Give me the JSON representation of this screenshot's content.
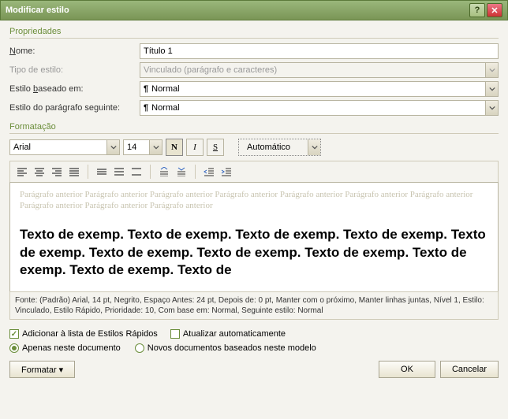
{
  "window": {
    "title": "Modificar estilo"
  },
  "sections": {
    "properties": "Propriedades",
    "formatting": "Formatação"
  },
  "props": {
    "name_label": "Nome:",
    "name_value": "Título 1",
    "styletype_label": "Tipo de estilo:",
    "styletype_value": "Vinculado (parágrafo e caracteres)",
    "basedon_label": "Estilo baseado em:",
    "basedon_value": "Normal",
    "followpara_label": "Estilo do parágrafo seguinte:",
    "followpara_value": "Normal"
  },
  "toolbar": {
    "font": "Arial",
    "size": "14",
    "bold": "N",
    "italic": "I",
    "underline": "S",
    "color": "Automático"
  },
  "preview": {
    "before": "Parágrafo anterior Parágrafo anterior Parágrafo anterior Parágrafo anterior Parágrafo anterior Parágrafo anterior Parágrafo anterior Parágrafo anterior Parágrafo anterior Parágrafo anterior",
    "sample": "Texto de exemp. Texto de exemp. Texto de exemp. Texto de exemp. Texto de exemp. Texto de exemp. Texto de exemp. Texto de exemp. Texto de exemp. Texto de exemp. Texto de"
  },
  "description": "Fonte: (Padrão) Arial, 14 pt, Negrito, Espaço Antes:  24 pt, Depois de:  0 pt, Manter com o próximo, Manter linhas juntas, Nível 1, Estilo: Vinculado, Estilo Rápido, Prioridade: 10, Com base em: Normal, Seguinte estilo: Normal",
  "checkboxes": {
    "quickstyle": "Adicionar à lista de Estilos Rápidos",
    "autoupdate": "Atualizar automaticamente"
  },
  "radios": {
    "thisdoc": "Apenas neste documento",
    "newdocs": "Novos documentos baseados neste modelo"
  },
  "buttons": {
    "format": "Formatar ▾",
    "ok": "OK",
    "cancel": "Cancelar"
  }
}
